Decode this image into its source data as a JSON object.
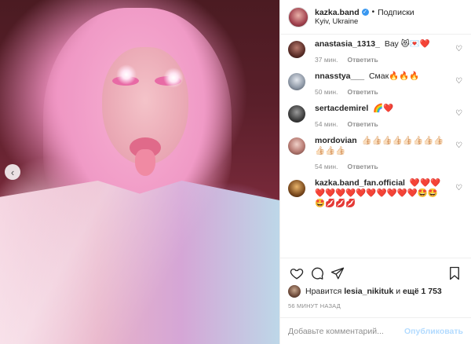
{
  "post": {
    "username": "kazka.band",
    "follow_label": "Подписки",
    "location": "Kyiv, Ukraine"
  },
  "comments": [
    {
      "user": "anastasia_1313_",
      "text": "Вау 😻💌❤️",
      "time": "37 мин.",
      "reply": "Ответить"
    },
    {
      "user": "nnasstya___",
      "text": "Смак🔥🔥🔥",
      "time": "50 мин.",
      "reply": "Ответить"
    },
    {
      "user": "sertacdemirel",
      "text": "🌈❤️",
      "time": "54 мин.",
      "reply": "Ответить"
    },
    {
      "user": "mordovian",
      "text": "👍🏻👍🏻👍🏻👍🏻👍🏻👍🏻👍🏻👍🏻👍🏻👍🏻👍🏻",
      "time": "54 мин.",
      "reply": "Ответить"
    },
    {
      "user": "kazka.band_fan.official",
      "text": "❤️❤️❤️❤️❤️❤️❤️❤️❤️❤️❤️❤️❤️🤩🤩🤩💋💋💋",
      "time": "",
      "reply": ""
    }
  ],
  "likes": {
    "prefix": "Нравится",
    "user": "lesia_nikituk",
    "middle": "и",
    "count_label": "ещё 1 753"
  },
  "time_ago": "56 МИНУТ НАЗАД",
  "add_comment": {
    "placeholder": "Добавьте комментарий...",
    "publish_label": "Опубликовать"
  },
  "colors": {
    "verified": "#3897f0",
    "publish_disabled": "#b3dbff",
    "muted": "#8e8e8e"
  },
  "icons": [
    "heart-icon",
    "comment-icon",
    "share-icon",
    "bookmark-icon",
    "verified-icon",
    "chevron-left-icon"
  ]
}
